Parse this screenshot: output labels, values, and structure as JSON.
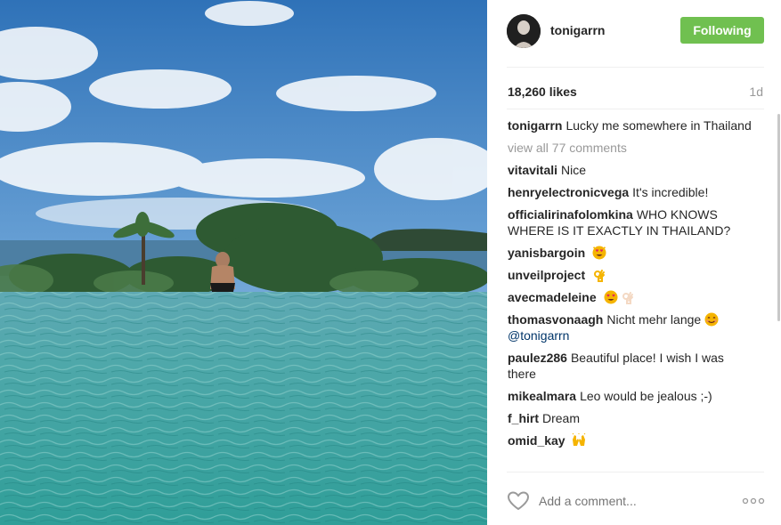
{
  "post": {
    "username": "tonigarrn",
    "follow_label": "Following",
    "likes": "18,260 likes",
    "time": "1d"
  },
  "caption": {
    "username": "tonigarrn",
    "text": "Lucky me somewhere in Thailand"
  },
  "view_all": "view all 77 comments",
  "comments": [
    {
      "username": "vitavitali",
      "text": "Nice"
    },
    {
      "username": "henryelectronicvega",
      "text": "It's incredible!"
    },
    {
      "username": "officialirinafolomkina",
      "text": "WHO KNOWS WHERE IS IT EXACTLY IN THAILAND?"
    },
    {
      "username": "yanisbargoin",
      "text": ""
    },
    {
      "username": "unveilproject",
      "text": ""
    },
    {
      "username": "avecmadeleine",
      "text": ""
    },
    {
      "username": "thomasvonaagh",
      "text": "Nicht mehr lange",
      "mention": "@tonigarrn"
    },
    {
      "username": "paulez286",
      "text": "Beautiful place! I wish I was there"
    },
    {
      "username": "mikealmara",
      "text": "Leo would be jealous ;-)"
    },
    {
      "username": "f_hirt",
      "text": "Dream"
    },
    {
      "username": "omid_kay",
      "text": ""
    }
  ],
  "comment_input": {
    "placeholder": "Add a comment..."
  },
  "icons": {
    "like": "heart-outline-icon",
    "more": "more-options-icon"
  },
  "colors": {
    "follow_button": "#70c050",
    "mention": "#003569",
    "muted": "#999999"
  }
}
